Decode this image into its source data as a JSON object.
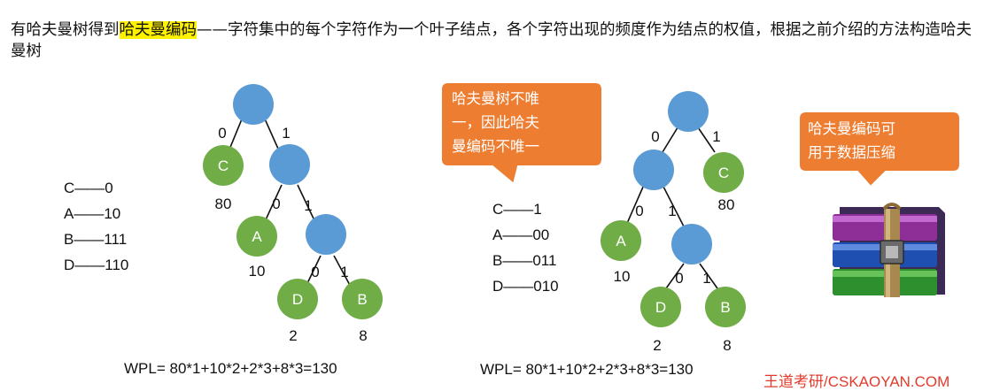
{
  "intro": {
    "before": "有哈夫曼树得到",
    "highlight": "哈夫曼编码",
    "after": "——字符集中的每个字符作为一个叶子结点，各个字符出现的频度作为结点的权值，根据之前介绍的方法构造哈夫曼树"
  },
  "left": {
    "codes": [
      "C——0",
      "A——10",
      "B——111",
      "D——110"
    ],
    "edge_labels": [
      "0",
      "1",
      "0",
      "1",
      "0",
      "1"
    ],
    "leaves": [
      {
        "name": "C",
        "weight": "80"
      },
      {
        "name": "A",
        "weight": "10"
      },
      {
        "name": "D",
        "weight": "2"
      },
      {
        "name": "B",
        "weight": "8"
      }
    ],
    "wpl": "WPL= 80*1+10*2+2*3+8*3=130"
  },
  "right": {
    "codes": [
      "C——1",
      "A——00",
      "B——011",
      "D——010"
    ],
    "edge_labels": [
      "0",
      "1",
      "0",
      "1",
      "0",
      "1"
    ],
    "leaves": [
      {
        "name": "C",
        "weight": "80"
      },
      {
        "name": "A",
        "weight": "10"
      },
      {
        "name": "D",
        "weight": "2"
      },
      {
        "name": "B",
        "weight": "8"
      }
    ],
    "wpl": "WPL= 80*1+10*2+2*3+8*3=130"
  },
  "callout_unique": [
    "哈夫曼树不唯",
    "一，因此哈夫",
    "曼编码不唯一"
  ],
  "callout_compress": [
    "哈夫曼编码可",
    "用于数据压缩"
  ],
  "archive_icon": "winrar-archive-icon",
  "watermark": "王道考研/CSKAOYAN.COM",
  "colors": {
    "internal_node": "#5b9bd5",
    "leaf_node": "#70ad47",
    "callout": "#ed7d31",
    "highlight": "#fff200"
  }
}
